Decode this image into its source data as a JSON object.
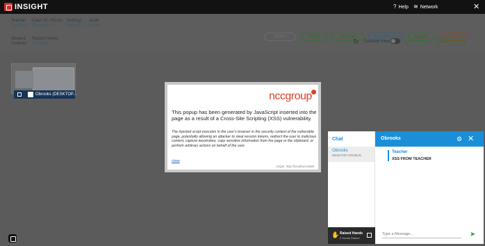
{
  "app": {
    "title": "INSIGHT"
  },
  "topbar": {
    "help": "Help",
    "network": "Network"
  },
  "toolbar": {
    "groups": [
      {
        "label": "Teacher",
        "sub": "Controls"
      },
      {
        "label": "Class ID / Room",
        "sub": "Computer ⓘ"
      },
      {
        "label": "Settings",
        "sub": "Default ⓘ"
      },
      {
        "label": "Audit",
        "sub": "Active"
      }
    ],
    "pills": [
      "DEMO",
      "SHARE",
      "ACTIONS",
      "CLASSROOM",
      "ACCESS",
      "PAUSE"
    ],
    "row2": [
      {
        "label": "Student",
        "sub": "Controls"
      },
      {
        "label": "Raised Hands",
        "sub": "0 Raised"
      }
    ],
    "detailed_view": "Detailed View",
    "layout_pill": "LAYOUT",
    "select_pill": "SELECT"
  },
  "student": {
    "name": "Obrooks (DESKTOP..."
  },
  "popup": {
    "brand": "nccgroup",
    "headline": "This popup has been generated by JavaScript inserted into the page as a result of a Cross-Site Scripting (XSS) vulnerability.",
    "body": "The injected script executes in the user's browser in the security context of the vulnerable page, potentially allowing an attacker to steal session tokens, redirect the user to malicious content, capture keystrokes, copy sensitive information from the page or the clipboard, or perform arbitrary actions on behalf of the user.",
    "close": "close",
    "origin": "Origin: http://localhost:8080"
  },
  "chat": {
    "title": "Chat",
    "contact": {
      "name": "Obrooks",
      "sub": "DESKTOP-CRO8UG"
    },
    "raised": {
      "title": "Raised Hands",
      "sub": "0 Hands Raised"
    },
    "header_name": "Obrooks",
    "message": {
      "from": "Teacher",
      "text": "XSS FROM TEACHER"
    },
    "input_placeholder": "Type a Message..."
  }
}
